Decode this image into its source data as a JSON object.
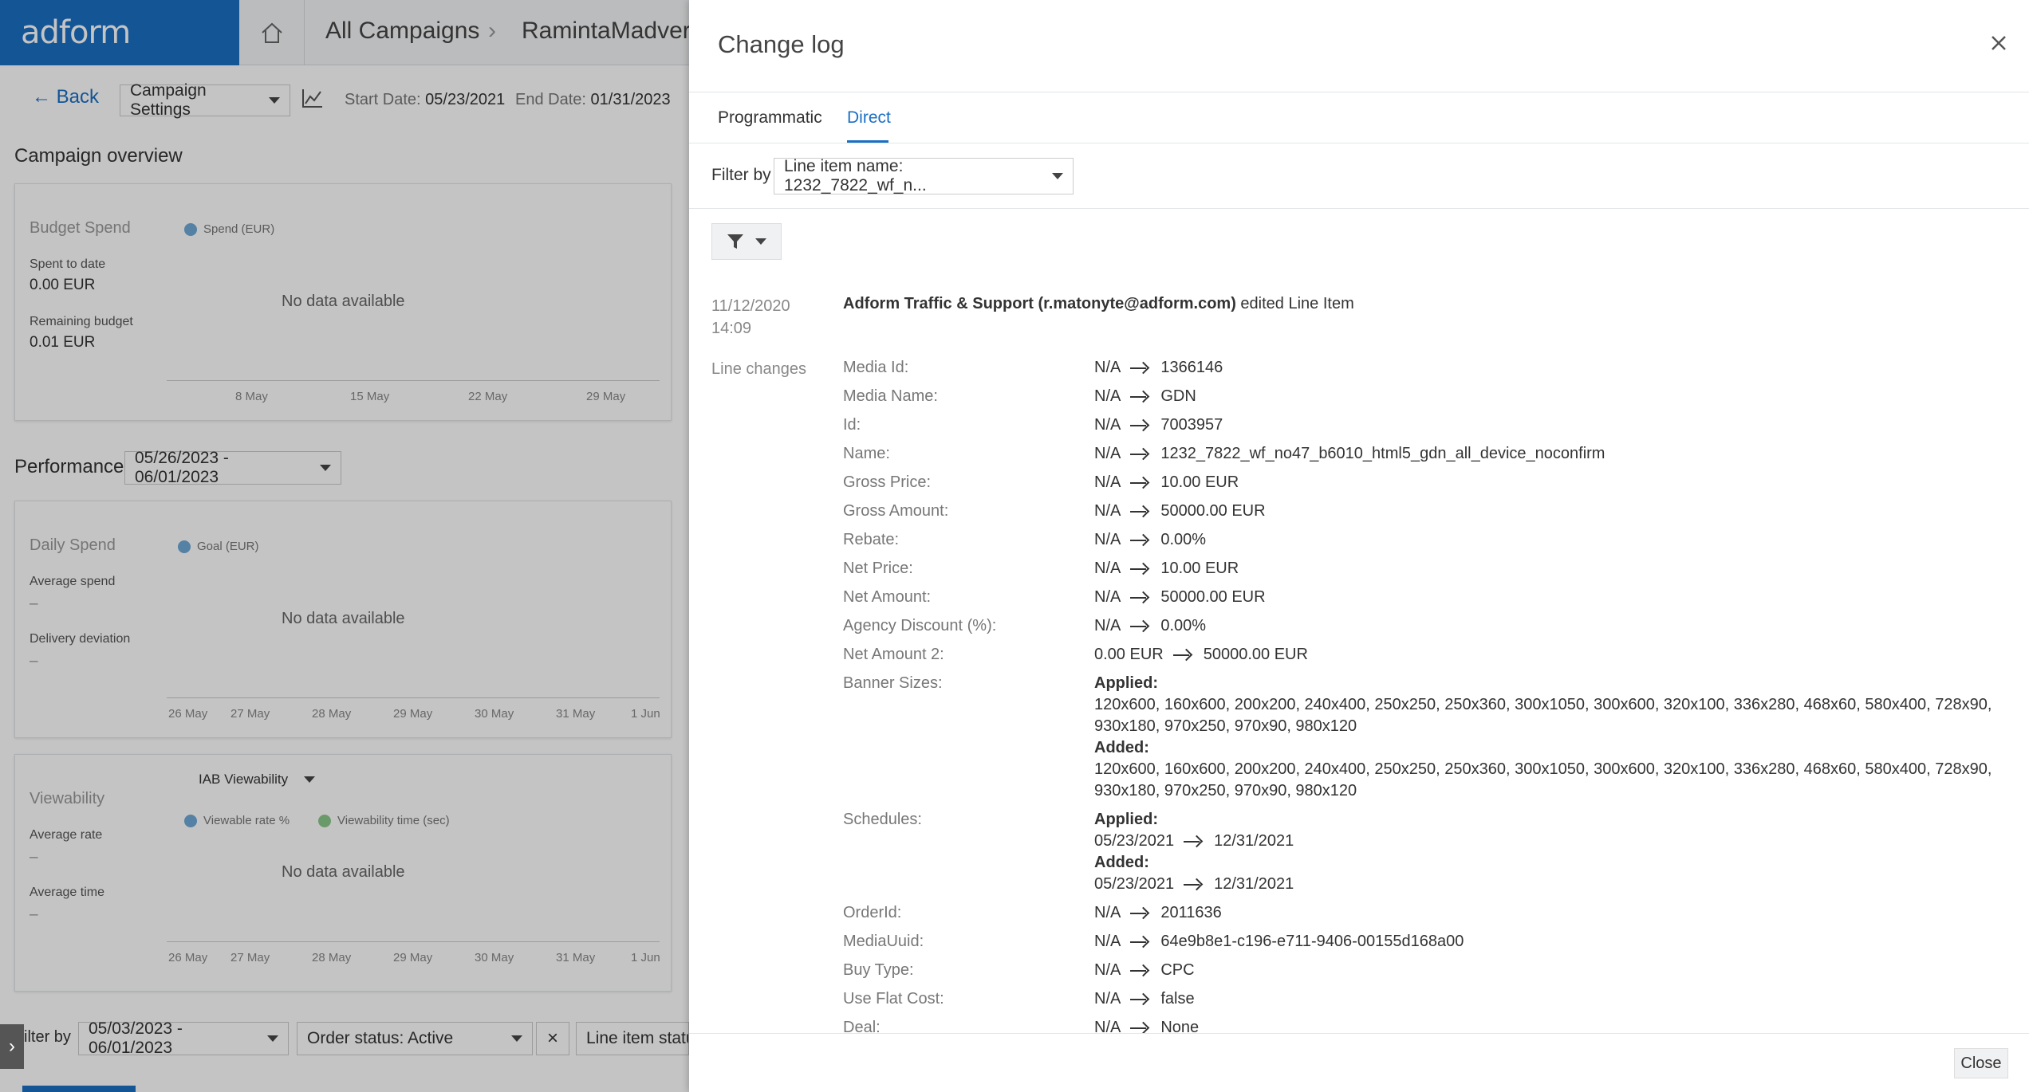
{
  "app": {
    "logo": "adform"
  },
  "breadcrumb": {
    "all_campaigns": "All Campaigns",
    "campaign": "RamintaMadvert"
  },
  "toolbar": {
    "back": "Back",
    "settings": "Campaign Settings",
    "start_label": "Start Date:",
    "start_value": "05/23/2021",
    "end_label": "End Date:",
    "end_value": "01/31/2023"
  },
  "overview": {
    "title": "Campaign overview",
    "budget": {
      "title": "Budget Spend",
      "legend": "Spend (EUR)",
      "spent_label": "Spent to date",
      "spent_value": "0.00 EUR",
      "remaining_label": "Remaining budget",
      "remaining_value": "0.01 EUR",
      "nodata": "No data available",
      "ticks": [
        "8 May",
        "15 May",
        "22 May",
        "29 May"
      ]
    }
  },
  "performance": {
    "title": "Performance",
    "range": "05/26/2023 - 06/01/2023",
    "daily": {
      "title": "Daily Spend",
      "legend": "Goal (EUR)",
      "avg_label": "Average spend",
      "avg_value": "–",
      "dev_label": "Delivery deviation",
      "dev_value": "–",
      "nodata": "No data available",
      "ticks": [
        "26 May",
        "27 May",
        "28 May",
        "29 May",
        "30 May",
        "31 May",
        "1 Jun"
      ]
    },
    "view": {
      "title": "Viewability",
      "select": "IAB Viewability",
      "legend1": "Viewable rate %",
      "legend2": "Viewability time (sec)",
      "rate_label": "Average rate",
      "rate_value": "–",
      "time_label": "Average time",
      "time_value": "–",
      "nodata": "No data available",
      "ticks": [
        "26 May",
        "27 May",
        "28 May",
        "29 May",
        "30 May",
        "31 May",
        "1 Jun"
      ]
    }
  },
  "bottom_filter": {
    "label": "ilter by",
    "date": "05/03/2023 - 06/01/2023",
    "status": "Order status: Active",
    "line_status": "Line item statu"
  },
  "changelog": {
    "title": "Change log",
    "tabs": [
      "Programmatic",
      "Direct"
    ],
    "filter_label": "Filter by",
    "filter_value": "Line item name: 1232_7822_wf_n...",
    "date": "11/12/2020",
    "time": "14:09",
    "user": "Adform Traffic & Support (r.matonyte@adform.com)",
    "action": " edited Line Item",
    "line_changes_label": "Line changes",
    "changes": [
      {
        "key": "Media Id:",
        "from": "N/A",
        "to": "1366146"
      },
      {
        "key": "Media Name:",
        "from": "N/A",
        "to": "GDN"
      },
      {
        "key": "Id:",
        "from": "N/A",
        "to": "7003957"
      },
      {
        "key": "Name:",
        "from": "N/A",
        "to": "1232_7822_wf_no47_b6010_html5_gdn_all_device_noconfirm"
      },
      {
        "key": "Gross Price:",
        "from": "N/A",
        "to": "10.00 EUR"
      },
      {
        "key": "Gross Amount:",
        "from": "N/A",
        "to": "50000.00 EUR"
      },
      {
        "key": "Rebate:",
        "from": "N/A",
        "to": "0.00%"
      },
      {
        "key": "Net Price:",
        "from": "N/A",
        "to": "10.00 EUR"
      },
      {
        "key": "Net Amount:",
        "from": "N/A",
        "to": "50000.00 EUR"
      },
      {
        "key": "Agency Discount (%):",
        "from": "N/A",
        "to": "0.00%"
      },
      {
        "key": "Net Amount 2:",
        "from": "0.00 EUR",
        "to": "50000.00 EUR"
      }
    ],
    "banner_key": "Banner Sizes:",
    "applied": "Applied:",
    "added": "Added:",
    "banner_list": "120x600, 160x600, 200x200, 240x400, 250x250, 250x360, 300x1050, 300x600, 320x100, 336x280, 468x60, 580x400, 728x90, 930x180, 970x250, 970x90, 980x120",
    "schedules_key": "Schedules:",
    "sched_from": "05/23/2021",
    "sched_to": "12/31/2021",
    "changes2": [
      {
        "key": "OrderId:",
        "from": "N/A",
        "to": "2011636"
      },
      {
        "key": "MediaUuid:",
        "from": "N/A",
        "to": "64e9b8e1-c196-e711-9406-00155d168a00"
      },
      {
        "key": "Buy Type:",
        "from": "N/A",
        "to": "CPC"
      },
      {
        "key": "Use Flat Cost:",
        "from": "N/A",
        "to": "false"
      },
      {
        "key": "Deal:",
        "from": "N/A",
        "to": "None"
      }
    ],
    "close": "Close"
  }
}
